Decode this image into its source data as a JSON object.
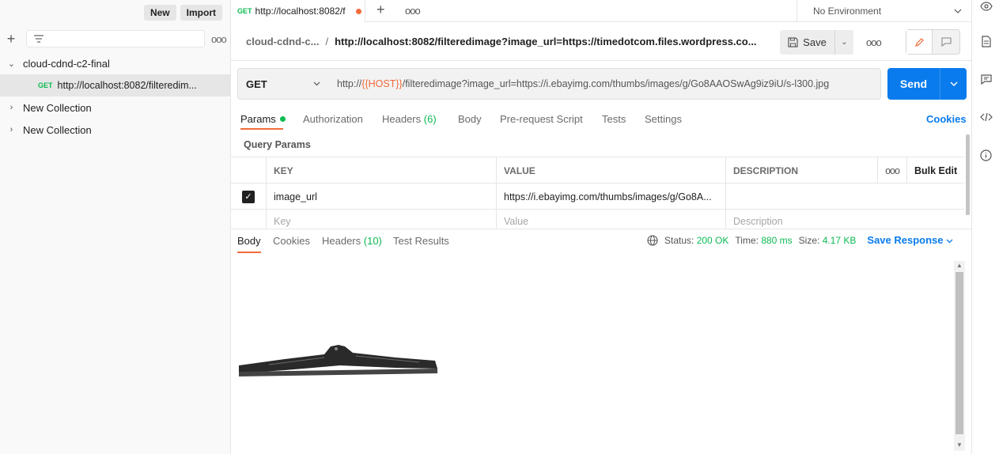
{
  "sidebar": {
    "new_label": "New",
    "import_label": "Import",
    "collections": [
      {
        "name": "cloud-cdnd-c2-final",
        "expanded": true,
        "requests": [
          {
            "method": "GET",
            "name": "http://localhost:8082/filteredim..."
          }
        ]
      },
      {
        "name": "New Collection",
        "expanded": false
      },
      {
        "name": "New Collection",
        "expanded": false
      }
    ]
  },
  "tabs": {
    "active": {
      "method": "GET",
      "title": "http://localhost:8082/f",
      "unsaved": true
    },
    "environment": "No Environment"
  },
  "header": {
    "collection": "cloud-cdnd-c...",
    "separator": "/",
    "request_name": "http://localhost:8082/filteredimage?image_url=https://timedotcom.files.wordpress.co...",
    "save_label": "Save"
  },
  "request": {
    "method": "GET",
    "url_prefix": "http://",
    "url_var": "{{HOST}}",
    "url_suffix": "/filteredimage?image_url=https://i.ebayimg.com/thumbs/images/g/Go8AAOSwAg9iz9iU/s-l300.jpg",
    "send_label": "Send",
    "tabs": {
      "params": "Params",
      "authorization": "Authorization",
      "headers": "Headers",
      "headers_count": "(6)",
      "body": "Body",
      "prerequest": "Pre-request Script",
      "tests": "Tests",
      "settings": "Settings"
    },
    "cookies_label": "Cookies",
    "query_params_title": "Query Params",
    "table": {
      "headers": {
        "key": "KEY",
        "value": "VALUE",
        "description": "DESCRIPTION",
        "bulk_edit": "Bulk Edit"
      },
      "rows": [
        {
          "checked": true,
          "key": "image_url",
          "value": "https://i.ebayimg.com/thumbs/images/g/Go8A...",
          "description": ""
        }
      ],
      "placeholders": {
        "key": "Key",
        "value": "Value",
        "description": "Description"
      }
    }
  },
  "response": {
    "tabs": {
      "body": "Body",
      "cookies": "Cookies",
      "headers": "Headers",
      "headers_count": "(10)",
      "test_results": "Test Results"
    },
    "status_label": "Status:",
    "status_value": "200 OK",
    "time_label": "Time:",
    "time_value": "880 ms",
    "size_label": "Size:",
    "size_value": "4.17 KB",
    "save_response_label": "Save Response"
  },
  "colors": {
    "accent": "#f26b3a",
    "primary": "#097bed",
    "success": "#0cbb52"
  }
}
